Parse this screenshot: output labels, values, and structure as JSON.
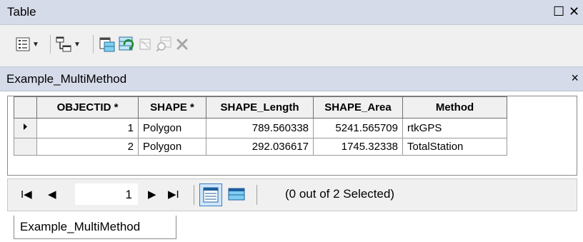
{
  "window": {
    "title": "Table",
    "restore_glyph": "☐",
    "close_glyph": "✕"
  },
  "toolbar": {
    "icons": [
      "table-options-icon",
      "related-tables-icon",
      "select-by-attributes-icon",
      "switch-selection-icon",
      "clear-selection-icon",
      "zoom-to-selected-icon",
      "delete-selected-icon"
    ]
  },
  "table_tab": {
    "title": "Example_MultiMethod",
    "close_glyph": "×"
  },
  "grid": {
    "columns": [
      "OBJECTID *",
      "SHAPE *",
      "SHAPE_Length",
      "SHAPE_Area",
      "Method"
    ],
    "rows": [
      {
        "objectid": "1",
        "shape": "Polygon",
        "length": "789.560338",
        "area": "5241.565709",
        "method": "rtkGPS",
        "current": true
      },
      {
        "objectid": "2",
        "shape": "Polygon",
        "length": "292.036617",
        "area": "1745.32338",
        "method": "TotalStation",
        "current": false
      }
    ]
  },
  "navigation": {
    "first_glyph": "I◀",
    "prev_glyph": "◀",
    "current_record": "1",
    "next_glyph": "▶",
    "last_glyph": "▶I",
    "status": "(0 out of 2 Selected)"
  },
  "bottom_tab": {
    "label": "Example_MultiMethod"
  }
}
